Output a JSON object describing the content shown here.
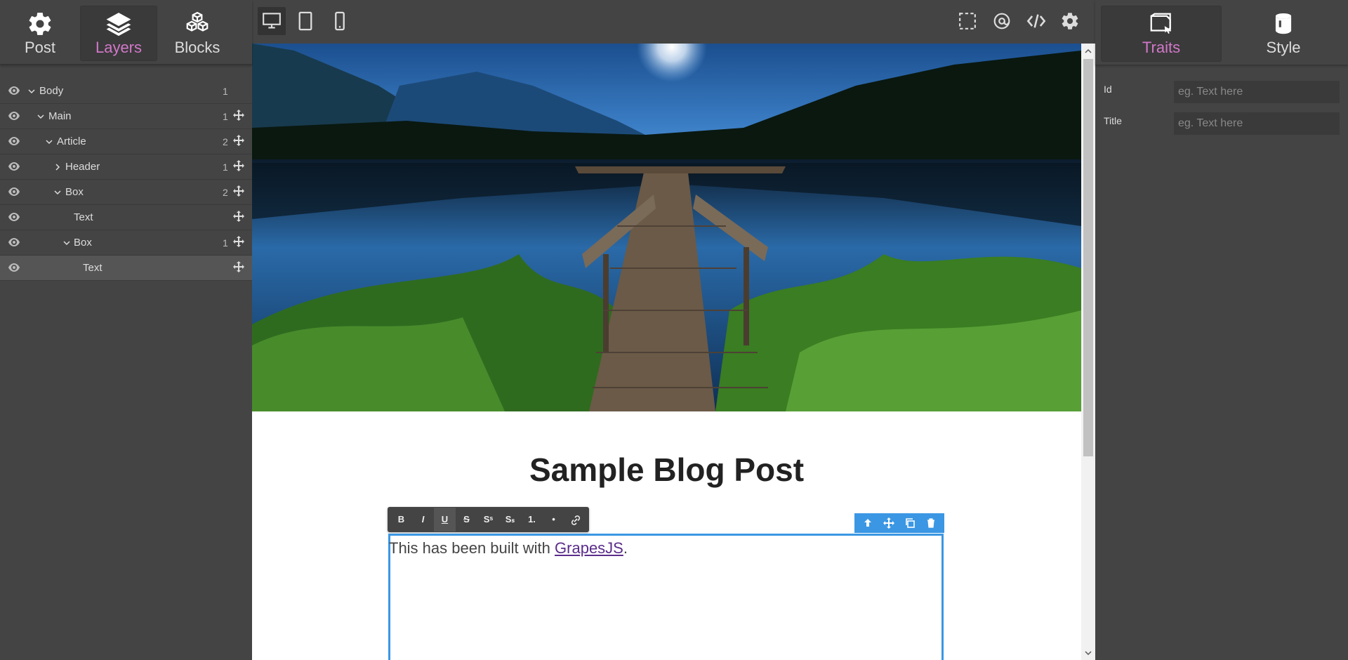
{
  "left_tabs": [
    {
      "label": "Post",
      "icon": "gear-icon"
    },
    {
      "label": "Layers",
      "icon": "layers-icon"
    },
    {
      "label": "Blocks",
      "icon": "cubes-icon"
    }
  ],
  "layers": [
    {
      "name": "Body",
      "count": "1"
    },
    {
      "name": "Main",
      "count": "1"
    },
    {
      "name": "Article",
      "count": "2"
    },
    {
      "name": "Header",
      "count": "1"
    },
    {
      "name": "Box",
      "count": "2"
    },
    {
      "name": "Text",
      "count": ""
    },
    {
      "name": "Box",
      "count": "1"
    },
    {
      "name": "Text",
      "count": ""
    }
  ],
  "canvas": {
    "title": "Sample Blog Post",
    "text_before": "This has been built with ",
    "link_text": "GrapesJS",
    "text_after": ".",
    "hero_image": "lake-pier-night-photo"
  },
  "rte": [
    "B",
    "I",
    "U",
    "S",
    "Sˢ",
    "Sₛ",
    "1.",
    "•",
    "link-icon"
  ],
  "right_tabs": [
    {
      "label": "Traits",
      "icon": "window-cursor-icon"
    },
    {
      "label": "Style",
      "icon": "paint-bucket-icon"
    }
  ],
  "traits": {
    "id_label": "Id",
    "id_placeholder": "eg. Text here",
    "title_label": "Title",
    "title_placeholder": "eg. Text here"
  },
  "colors": {
    "accent": "#d278c9",
    "selection": "#3b97e3",
    "panel": "#444444"
  }
}
